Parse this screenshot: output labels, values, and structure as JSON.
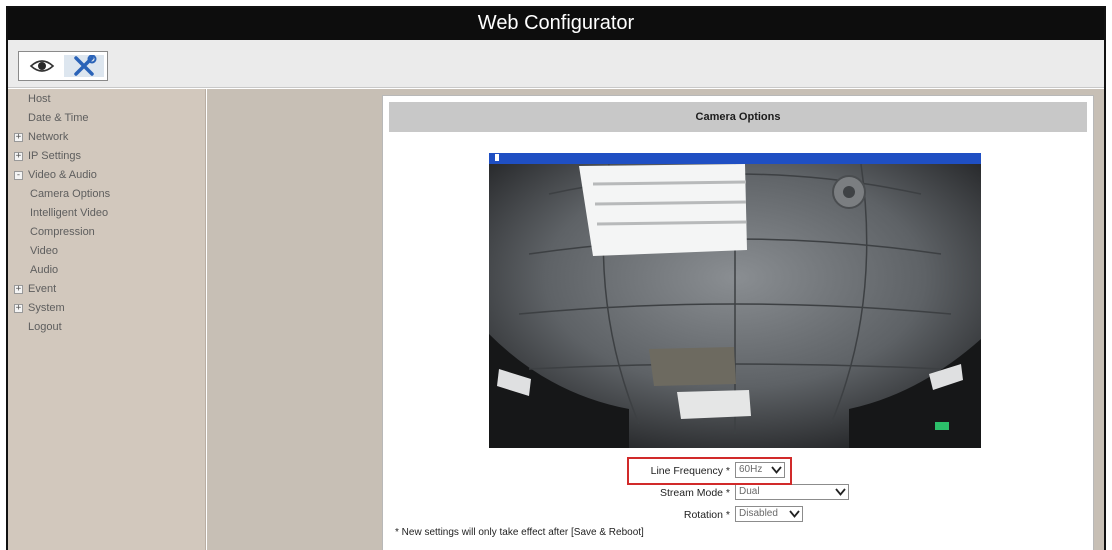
{
  "app": {
    "title": "Web Configurator"
  },
  "toolbar": {
    "buttons": [
      {
        "icon": "eye-icon",
        "label": "View"
      },
      {
        "icon": "tools-icon",
        "label": "Setup"
      }
    ]
  },
  "sidebar": {
    "items": [
      {
        "label": "Host",
        "expander": ""
      },
      {
        "label": "Date & Time",
        "expander": ""
      },
      {
        "label": "Network",
        "expander": "+"
      },
      {
        "label": "IP Settings",
        "expander": "+"
      },
      {
        "label": "Video & Audio",
        "expander": "-"
      },
      {
        "label": "Camera Options",
        "expander": ""
      },
      {
        "label": "Intelligent Video",
        "expander": ""
      },
      {
        "label": "Compression",
        "expander": ""
      },
      {
        "label": "Video",
        "expander": ""
      },
      {
        "label": "Audio",
        "expander": ""
      },
      {
        "label": "Event",
        "expander": "+"
      },
      {
        "label": "System",
        "expander": "+"
      },
      {
        "label": "Logout",
        "expander": ""
      }
    ]
  },
  "panel": {
    "title": "Camera Options",
    "fields": {
      "line_frequency": {
        "label": "Line Frequency *",
        "value": "60Hz"
      },
      "stream_mode": {
        "label": "Stream Mode *",
        "value": "Dual"
      },
      "rotation": {
        "label": "Rotation *",
        "value": "Disabled"
      }
    },
    "note": "* New settings will only take effect after [Save & Reboot]"
  },
  "colors": {
    "title_bar": "#0d0d0d",
    "sidebar_bg": "#d2c8bd",
    "main_bg": "#c7bfb5",
    "panel_header_bg": "#c8c8c8",
    "highlight": "#d12a2a",
    "video_status_bar": "#1f4fc3"
  }
}
